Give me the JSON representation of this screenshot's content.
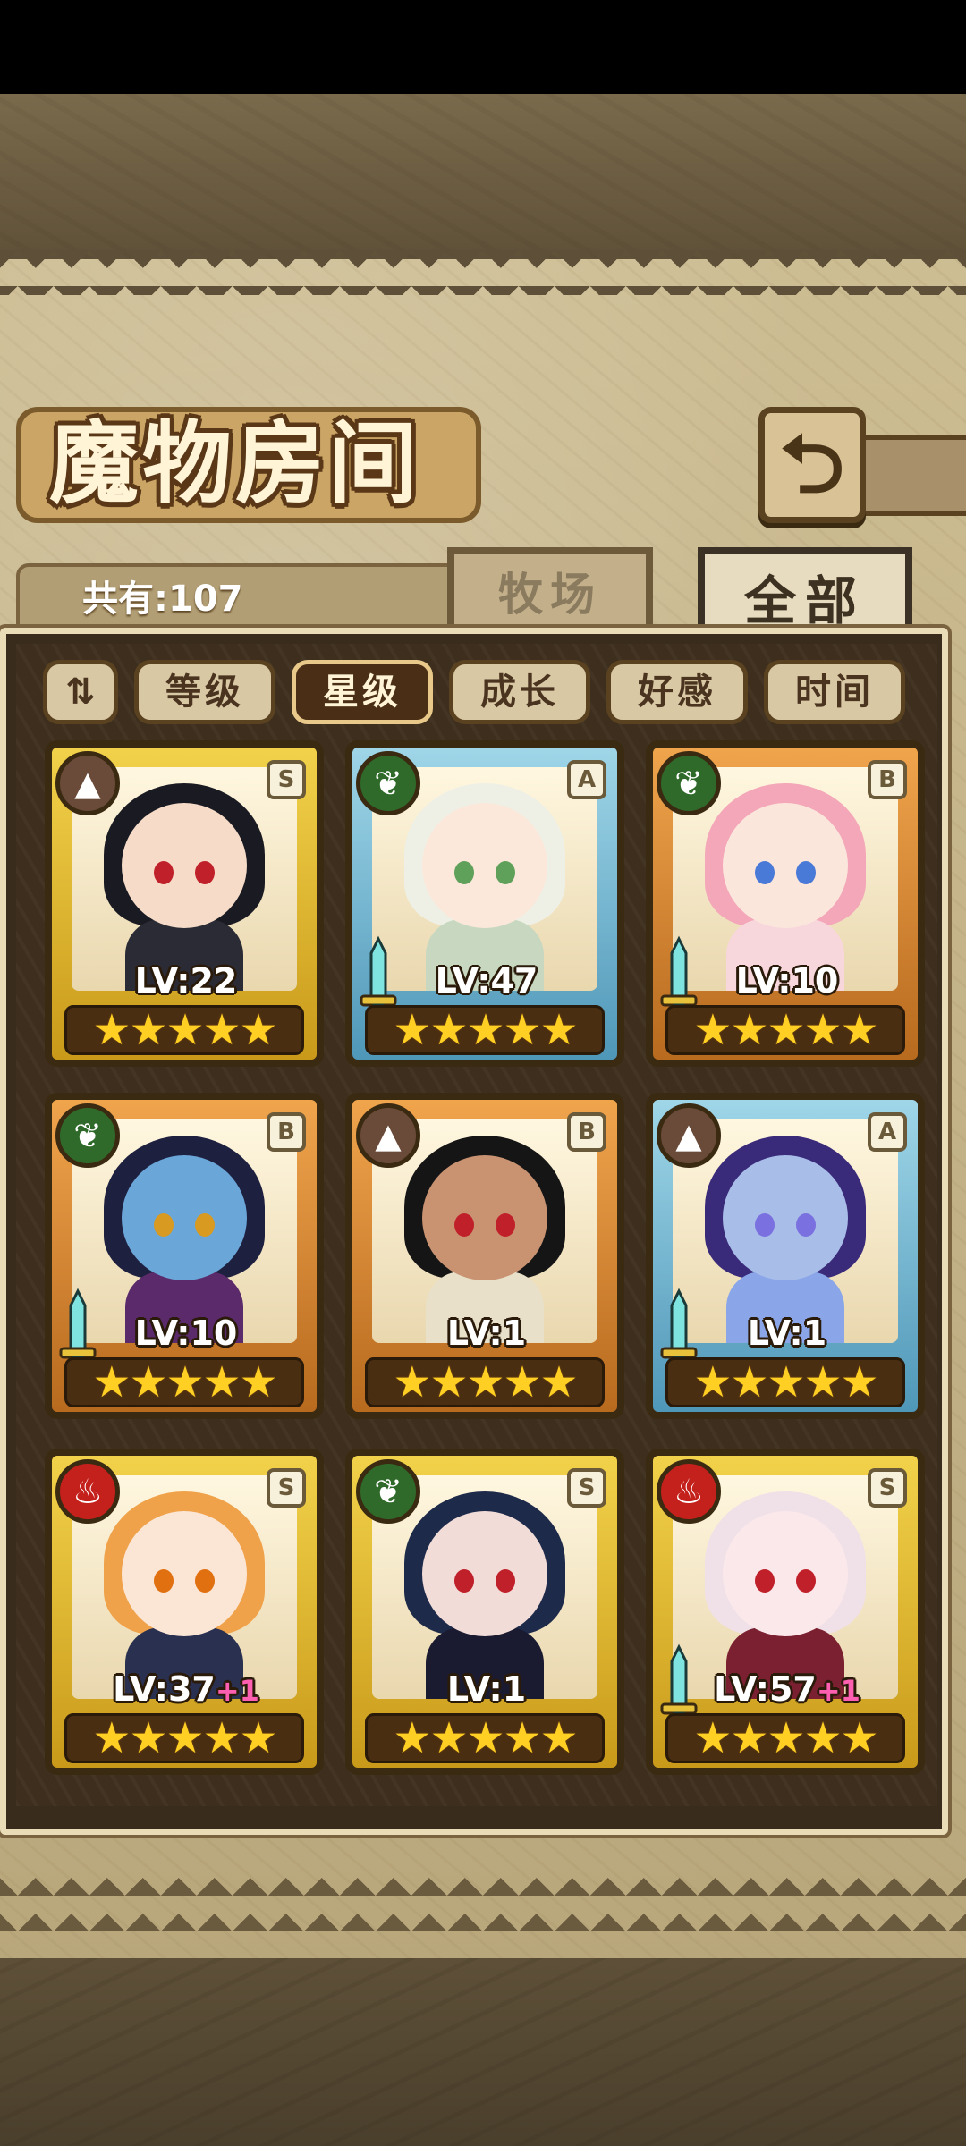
{
  "page": {
    "title": "魔物房间",
    "back_icon": "back-arrow-icon"
  },
  "tabs": {
    "count_label": "共有:107",
    "ranch_label": "牧场",
    "all_label": "全部",
    "active": "全部"
  },
  "sort_bar": {
    "toggle_icon": "sort-order-icon",
    "toggle_glyph": "⇅",
    "buttons": [
      {
        "label": "等级",
        "active": false
      },
      {
        "label": "星级",
        "active": true
      },
      {
        "label": "成长",
        "active": false
      },
      {
        "label": "好感",
        "active": false
      },
      {
        "label": "时间",
        "active": false
      }
    ]
  },
  "monsters": [
    {
      "level_label": "LV:22",
      "plus": "",
      "grade": "S",
      "element": "earth",
      "stars": "★★★★★",
      "has_sword": false
    },
    {
      "level_label": "LV:47",
      "plus": "",
      "grade": "A",
      "element": "leaf",
      "stars": "★★★★★",
      "has_sword": true
    },
    {
      "level_label": "LV:10",
      "plus": "",
      "grade": "B",
      "element": "leaf",
      "stars": "★★★★★",
      "has_sword": true
    },
    {
      "level_label": "LV:10",
      "plus": "",
      "grade": "B",
      "element": "leaf",
      "stars": "★★★★★",
      "has_sword": true
    },
    {
      "level_label": "LV:1",
      "plus": "",
      "grade": "B",
      "element": "earth",
      "stars": "★★★★★",
      "has_sword": false
    },
    {
      "level_label": "LV:1",
      "plus": "",
      "grade": "A",
      "element": "earth",
      "stars": "★★★★★",
      "has_sword": true
    },
    {
      "level_label": "LV:37",
      "plus": "+1",
      "grade": "S",
      "element": "fire",
      "stars": "★★★★★",
      "has_sword": false
    },
    {
      "level_label": "LV:1",
      "plus": "",
      "grade": "S",
      "element": "leaf",
      "stars": "★★★★★",
      "has_sword": false
    },
    {
      "level_label": "LV:57",
      "plus": "+1",
      "grade": "S",
      "element": "fire",
      "stars": "★★★★★",
      "has_sword": true
    }
  ],
  "colors": {
    "star": "#ffcf24",
    "plus_text": "#ff5fb0",
    "element_fire": "#c4211c",
    "element_leaf": "#2f6a2a",
    "element_earth": "#6a4a38"
  }
}
